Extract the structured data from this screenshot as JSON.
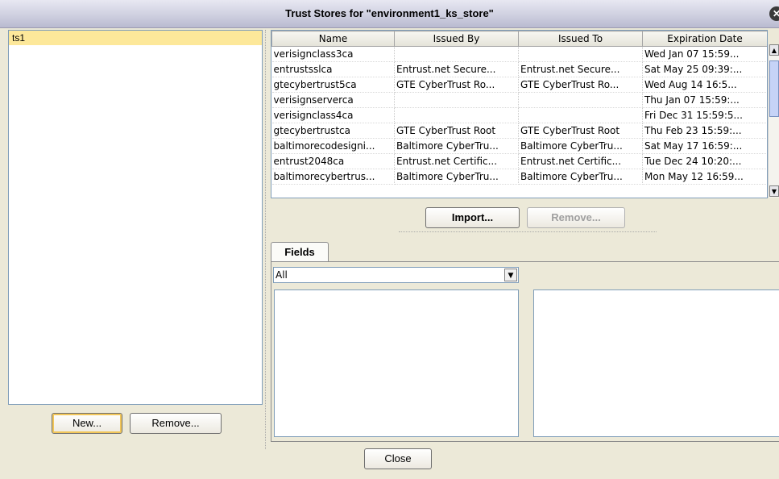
{
  "dialog": {
    "title": "Trust Stores for \"environment1_ks_store\""
  },
  "stores": {
    "items": [
      "ts1"
    ],
    "new_label": "New...",
    "remove_label": "Remove..."
  },
  "certificates": {
    "columns": [
      "Name",
      "Issued By",
      "Issued To",
      "Expiration Date"
    ],
    "rows": [
      [
        "verisignclass3ca",
        "",
        "",
        "Wed Jan 07 15:59..."
      ],
      [
        "entrustsslca",
        "Entrust.net Secure...",
        "Entrust.net Secure...",
        "Sat May 25 09:39:..."
      ],
      [
        "gtecybertrust5ca",
        "GTE CyberTrust Ro...",
        "GTE CyberTrust Ro...",
        "Wed Aug 14 16:5..."
      ],
      [
        "verisignserverca",
        "",
        "",
        "Thu Jan 07 15:59:..."
      ],
      [
        "verisignclass4ca",
        "",
        "",
        "Fri Dec 31 15:59:5..."
      ],
      [
        "gtecybertrustca",
        "GTE CyberTrust Root",
        "GTE CyberTrust Root",
        "Thu Feb 23 15:59:..."
      ],
      [
        "baltimorecodesigni...",
        "Baltimore CyberTru...",
        "Baltimore CyberTru...",
        "Sat May 17 16:59:..."
      ],
      [
        "entrust2048ca",
        "Entrust.net Certific...",
        "Entrust.net Certific...",
        "Tue Dec 24 10:20:..."
      ],
      [
        "baltimorecybertrus...",
        "Baltimore CyberTru...",
        "Baltimore CyberTru...",
        "Mon May 12 16:59..."
      ]
    ],
    "import_label": "Import...",
    "remove_label": "Remove..."
  },
  "fields": {
    "tab_label": "Fields",
    "filter_value": "All"
  },
  "footer": {
    "close_label": "Close"
  },
  "icons": {
    "close": "close-icon",
    "scroll_up": "scroll-up-arrow-icon",
    "scroll_down": "scroll-down-arrow-icon",
    "dropdown": "chevron-down-icon"
  },
  "colors": {
    "selection": "#fde89a",
    "background": "#ece9d8"
  }
}
